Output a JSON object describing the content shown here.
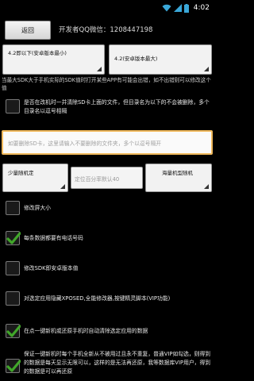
{
  "status_bar": {
    "time": "4:02"
  },
  "header": {
    "back_label": "返回",
    "developer_text": "开发者QQ微信：1208447198"
  },
  "spinners": {
    "min_version": "4.2即以下(安卓版本最小)",
    "max_version": "4.2(安卓版本最大)"
  },
  "sdk_warning": "当最大SDK大于手机实际的SDK值时打开某些APP有可能会出错，如不出错则可以修改这个值",
  "options": {
    "delete_created_files": "是否在改机时一并清除SD卡上面的文件，但目录名为以下的不会被删除，多个目录名以逗号相隔",
    "modify_screen_size": "修改屏大小",
    "phone_number": "每条数据都要有电话号码",
    "modify_sdk": "修改SDK即安卓版本值",
    "xposed": "对选定应用隐藏XPOSED,全能修改器,按键精灵脚本(VIP功能)",
    "auto_clear": "在点一键新机或还原手机时自动清除选定应用的数据",
    "restore_note": "保证一键新机时每个手机全新从不被用过且永不重复，普通VIP如勾选，则得到的数据是每天显示无限可以，这样的是无法再还原，我等数据库VIP用户，得到的数据是可以再还原"
  },
  "checkbox_states": {
    "delete_created_files": false,
    "modify_screen_size": false,
    "phone_number": true,
    "modify_sdk": false,
    "xposed": false,
    "auto_clear": true,
    "restore_note": true
  },
  "sd_delete_input": {
    "placeholder": "如要删除SD卡，这里请输入不要删除的文件夹，多个以逗号隔开"
  },
  "random_row": {
    "mode_spinner": "少量随机定",
    "percent_placeholder": "定位百分率默认40",
    "model_spinner": "海量机型随机"
  },
  "colors": {
    "background": "#000000",
    "check_green": "#41a62a",
    "input_border_focus": "#f0b95c"
  }
}
